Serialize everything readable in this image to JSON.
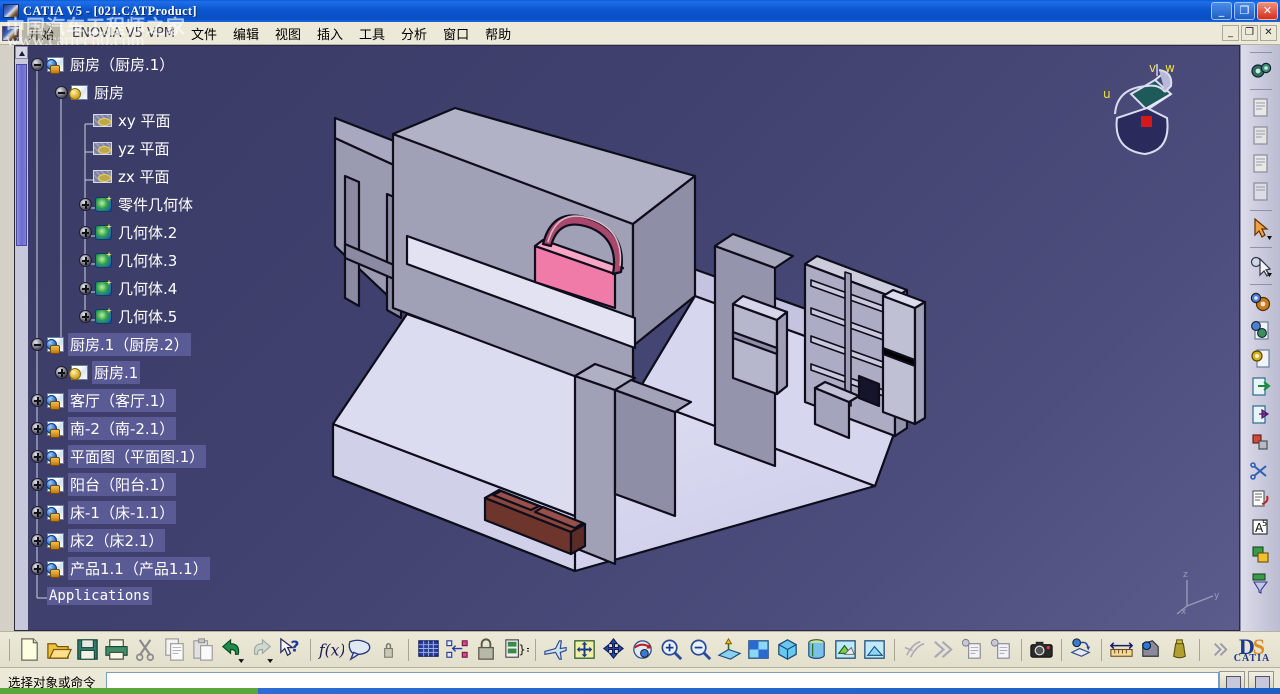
{
  "window": {
    "title": "CATIA V5 - [021.CATProduct]",
    "minimize_label": "_",
    "maximize_label": "❐",
    "close_label": "✕"
  },
  "watermark": {
    "line1": "中国汽车工程师之家",
    "line2": "www.cartech0.com"
  },
  "menubar": {
    "start_label": "开始",
    "items": [
      {
        "label": "ENOVIA V5 VPM"
      },
      {
        "label": "文件"
      },
      {
        "label": "编辑"
      },
      {
        "label": "视图"
      },
      {
        "label": "插入"
      },
      {
        "label": "工具"
      },
      {
        "label": "分析"
      },
      {
        "label": "窗口"
      },
      {
        "label": "帮助"
      }
    ],
    "mdi": {
      "minimize": "_",
      "restore": "❐",
      "close": "✕"
    }
  },
  "tree": {
    "nodes": [
      {
        "label": "厨房（厨房.1）",
        "indent": 0,
        "icon": "product-icon",
        "expander": "minus",
        "selected": false
      },
      {
        "label": "厨房",
        "indent": 1,
        "icon": "part-icon",
        "expander": "minus",
        "selected": false
      },
      {
        "label": "xy 平面",
        "indent": 2,
        "icon": "plane-icon",
        "expander": "none",
        "selected": false
      },
      {
        "label": "yz 平面",
        "indent": 2,
        "icon": "plane-icon",
        "expander": "none",
        "selected": false
      },
      {
        "label": "zx 平面",
        "indent": 2,
        "icon": "plane-icon",
        "expander": "none",
        "selected": false
      },
      {
        "label": "零件几何体",
        "indent": 2,
        "icon": "body-icon",
        "expander": "plus",
        "selected": false
      },
      {
        "label": "几何体.2",
        "indent": 2,
        "icon": "body-icon",
        "expander": "plus",
        "selected": false
      },
      {
        "label": "几何体.3",
        "indent": 2,
        "icon": "body-icon",
        "expander": "plus",
        "selected": false
      },
      {
        "label": "几何体.4",
        "indent": 2,
        "icon": "body-icon",
        "expander": "plus",
        "selected": false
      },
      {
        "label": "几何体.5",
        "indent": 2,
        "icon": "body-icon",
        "expander": "plus",
        "selected": false
      },
      {
        "label": "厨房.1（厨房.2）",
        "indent": 0,
        "icon": "product-icon",
        "expander": "minus",
        "selected": true
      },
      {
        "label": "厨房.1",
        "indent": 1,
        "icon": "part-icon",
        "expander": "plus",
        "selected": true
      },
      {
        "label": "客厅（客厅.1）",
        "indent": 0,
        "icon": "product-icon",
        "expander": "plus",
        "selected": true
      },
      {
        "label": "南-2（南-2.1）",
        "indent": 0,
        "icon": "product-icon",
        "expander": "plus",
        "selected": true
      },
      {
        "label": "平面图（平面图.1）",
        "indent": 0,
        "icon": "product-icon",
        "expander": "plus",
        "selected": true
      },
      {
        "label": "阳台（阳台.1）",
        "indent": 0,
        "icon": "product-icon",
        "expander": "plus",
        "selected": true
      },
      {
        "label": "床-1（床-1.1）",
        "indent": 0,
        "icon": "product-icon",
        "expander": "plus",
        "selected": true
      },
      {
        "label": "床2（床2.1）",
        "indent": 0,
        "icon": "product-icon",
        "expander": "plus",
        "selected": true
      },
      {
        "label": "产品1.1（产品1.1）",
        "indent": 0,
        "icon": "product-icon",
        "expander": "plus",
        "selected": true
      },
      {
        "label": "Applications",
        "indent": 0,
        "icon": "none",
        "expander": "none",
        "selected": true,
        "plain": true
      }
    ]
  },
  "compass": {
    "u_label": "u",
    "v_label": "v",
    "w_label": "w"
  },
  "axis_triad": {
    "x_label": "x",
    "y_label": "y",
    "z_label": "z"
  },
  "viewport": {
    "background_color": "#41416f",
    "model_description": "Isometric architectural floor plan assembly: walls, floors, bed, cabinets and shelves",
    "colors": {
      "wall": "#9a9ab0",
      "wall_dark": "#85859c",
      "floor": "#d8d8ee",
      "bed_pink": "#f07ba8",
      "bed_pink_dark": "#a8486a",
      "sofa_brown": "#8b463c",
      "sofa_brown_dark": "#6e352d",
      "outline": "#0d0d1c"
    }
  },
  "bottom_toolbar": {
    "items": [
      {
        "name": "new-document-icon",
        "tip": "新建"
      },
      {
        "name": "open-document-icon",
        "tip": "打开"
      },
      {
        "name": "save-icon",
        "tip": "保存"
      },
      {
        "name": "print-icon",
        "tip": "打印"
      },
      {
        "name": "cut-icon",
        "tip": "剪切"
      },
      {
        "name": "copy-icon",
        "tip": "复制"
      },
      {
        "name": "paste-icon",
        "tip": "粘贴"
      },
      {
        "name": "undo-icon",
        "tip": "撤销"
      },
      {
        "name": "redo-icon",
        "tip": "重做"
      },
      {
        "name": "whats-this-icon",
        "tip": "这是什么"
      },
      {
        "name": "formula-icon",
        "tip": "f(x)"
      },
      {
        "name": "comment-icon",
        "tip": "注释"
      },
      {
        "name": "lock-small-icon",
        "tip": "锁定"
      },
      {
        "name": "table-icon",
        "tip": "设计表"
      },
      {
        "name": "constraint-icon",
        "tip": "约束"
      },
      {
        "name": "lock-icon",
        "tip": "锁定"
      },
      {
        "name": "parameters-icon",
        "tip": "参数"
      },
      {
        "name": "fly-mode-icon",
        "tip": "飞行模式"
      },
      {
        "name": "fit-all-icon",
        "tip": "全部适应"
      },
      {
        "name": "pan-icon",
        "tip": "平移"
      },
      {
        "name": "rotate-icon",
        "tip": "旋转"
      },
      {
        "name": "zoom-in-icon",
        "tip": "放大"
      },
      {
        "name": "zoom-out-icon",
        "tip": "缩小"
      },
      {
        "name": "normal-view-icon",
        "tip": "法视图"
      },
      {
        "name": "multi-view-icon",
        "tip": "多视图"
      },
      {
        "name": "isometric-view-icon",
        "tip": "等轴测视图"
      },
      {
        "name": "render-style-icon",
        "tip": "渲染样式"
      },
      {
        "name": "hide-show-icon",
        "tip": "隐藏/显示"
      },
      {
        "name": "swap-space-icon",
        "tip": "交换可见空间"
      },
      {
        "name": "fast-forward-icon",
        "tip": "快进"
      },
      {
        "name": "skip-icon",
        "tip": "跳过"
      },
      {
        "name": "catalog-icon",
        "tip": "目录"
      },
      {
        "name": "catalog-2-icon",
        "tip": "目录"
      },
      {
        "name": "camera-icon",
        "tip": "捕获图像"
      },
      {
        "name": "apply-material-icon",
        "tip": "应用材料"
      },
      {
        "name": "measure-between-icon",
        "tip": "测量间距"
      },
      {
        "name": "measure-item-icon",
        "tip": "测量项"
      },
      {
        "name": "measure-inertia-icon",
        "tip": "测量惯量"
      },
      {
        "name": "chevron-right-icon",
        "tip": "更多"
      }
    ],
    "ds_logo": {
      "d": "D",
      "s": "S",
      "caption": "CATIA"
    }
  },
  "right_toolbar": {
    "items": [
      {
        "name": "gears-icon"
      },
      {
        "name": "document-1-icon"
      },
      {
        "name": "document-2-icon"
      },
      {
        "name": "document-3-icon"
      },
      {
        "name": "document-4-icon"
      },
      {
        "name": "select-arrow-icon"
      },
      {
        "name": "select-gear-icon"
      },
      {
        "name": "assembly-gear-icon"
      },
      {
        "name": "product-gear-icon"
      },
      {
        "name": "part-gear-icon"
      },
      {
        "name": "export-icon"
      },
      {
        "name": "publish-icon"
      },
      {
        "name": "copy-paste-icon"
      },
      {
        "name": "scissors-icon"
      },
      {
        "name": "list-undo-icon"
      },
      {
        "name": "annotation-text-icon"
      },
      {
        "name": "window-overlay-icon"
      },
      {
        "name": "filter-icon"
      }
    ]
  },
  "statusbar": {
    "message": "选择对象或命令",
    "input_value": "",
    "buttons": [
      {
        "name": "status-window-button"
      },
      {
        "name": "status-power-input-button"
      }
    ]
  }
}
